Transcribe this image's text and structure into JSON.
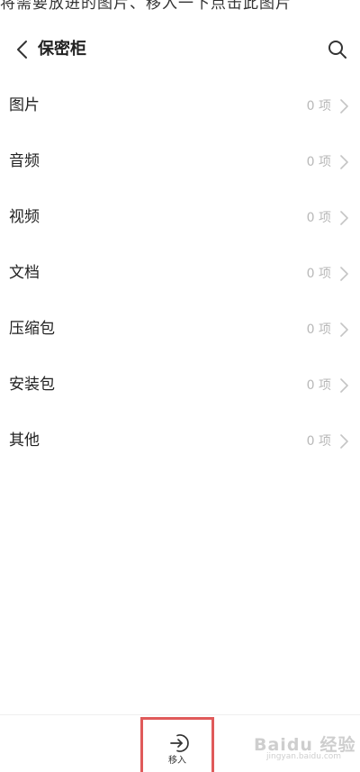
{
  "caption": "将需要放进的图片、移入一下点击此图片",
  "header": {
    "title": "保密柜",
    "back_icon": "chevron-left-icon",
    "search_icon": "search-icon"
  },
  "categories": [
    {
      "label": "图片",
      "count": "0 项"
    },
    {
      "label": "音频",
      "count": "0 项"
    },
    {
      "label": "视频",
      "count": "0 项"
    },
    {
      "label": "文档",
      "count": "0 项"
    },
    {
      "label": "压缩包",
      "count": "0 项"
    },
    {
      "label": "安装包",
      "count": "0 项"
    },
    {
      "label": "其他",
      "count": "0 项"
    }
  ],
  "bottom_bar": {
    "move_in_label": "移入",
    "highlight_color": "#e05a5a"
  },
  "watermark": {
    "text": "Baidu 经验",
    "sub": "jingyan.baidu.com"
  }
}
